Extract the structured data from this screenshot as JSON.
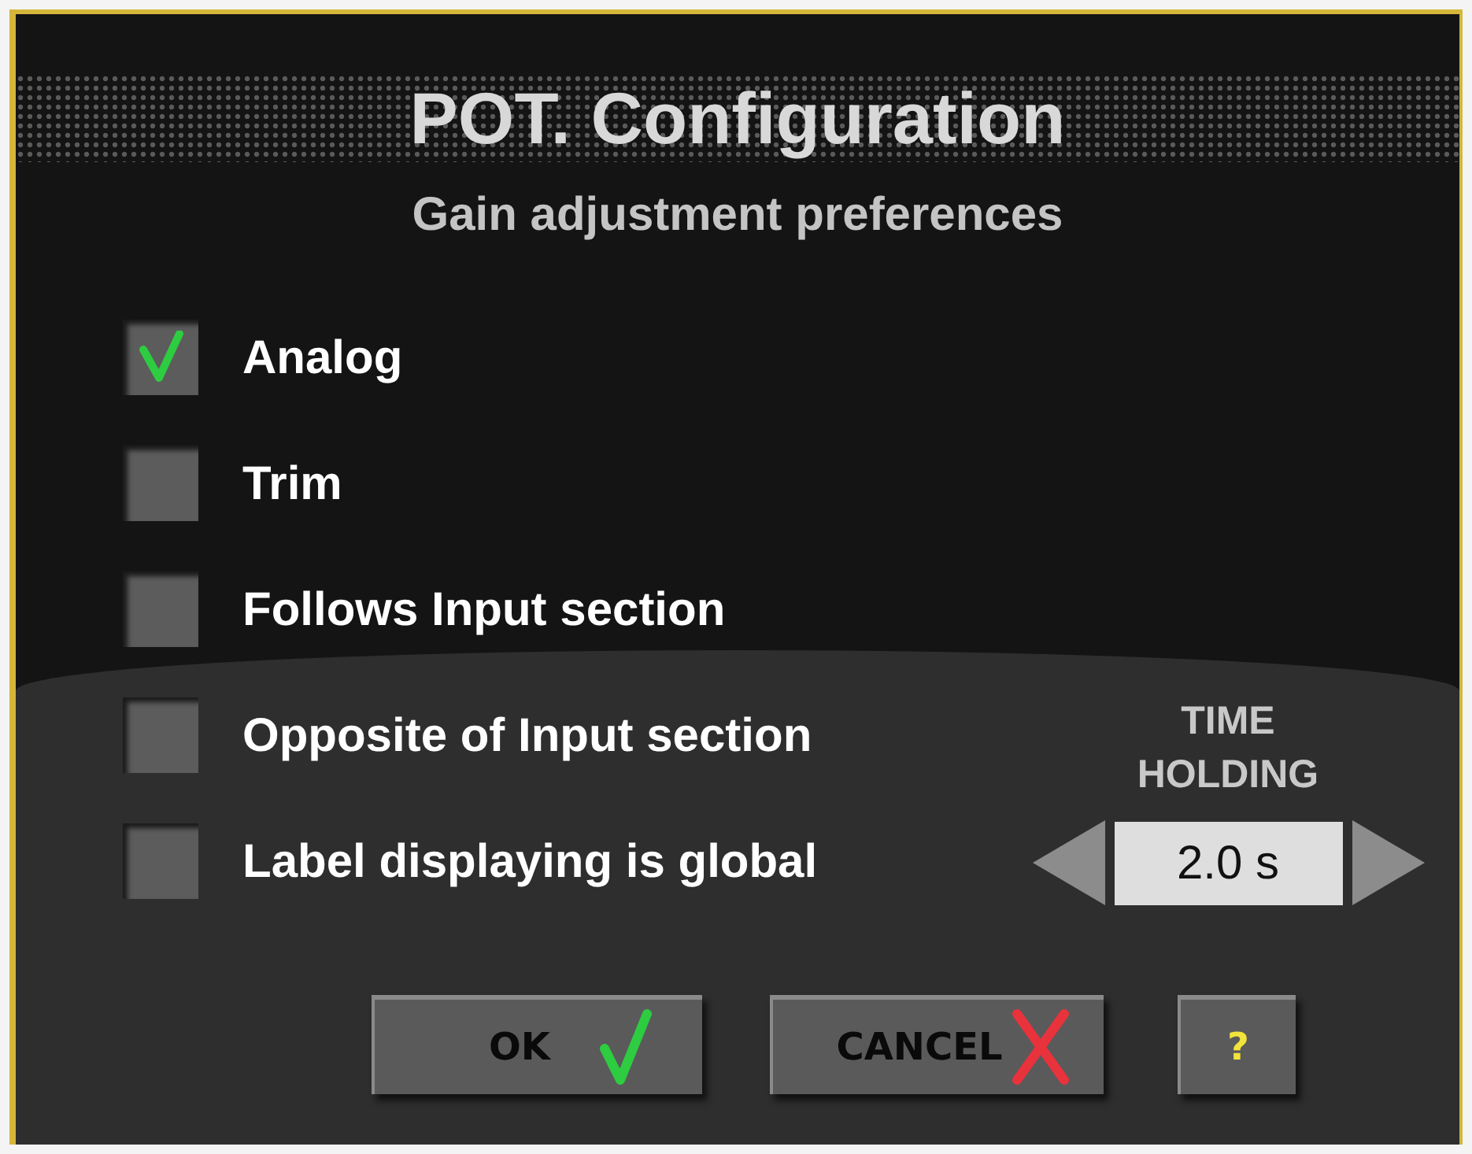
{
  "dialog": {
    "title": "POT. Configuration",
    "subtitle": "Gain adjustment preferences"
  },
  "options": [
    {
      "label": "Analog",
      "checked": true
    },
    {
      "label": "Trim",
      "checked": false
    },
    {
      "label": "Follows Input section",
      "checked": false
    },
    {
      "label": "Opposite of Input section",
      "checked": false
    },
    {
      "label": "Label displaying is global",
      "checked": false
    }
  ],
  "time_holding": {
    "label": "TIME HOLDING",
    "value": "2.0 s"
  },
  "buttons": [
    {
      "label": "OK",
      "kind": "ok"
    },
    {
      "label": "CANCEL",
      "kind": "cancel"
    },
    {
      "label": "?",
      "kind": "help"
    }
  ]
}
